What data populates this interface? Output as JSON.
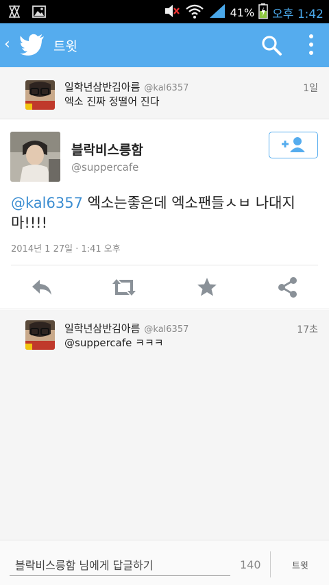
{
  "status_bar": {
    "battery": "41%",
    "time": "오후 1:42"
  },
  "header": {
    "title": "트윗"
  },
  "replies_above": [
    {
      "name": "일학년삼반김아름",
      "handle": "@kal6357",
      "time": "1일",
      "text": "엑소 진짜 정떨어 진다"
    }
  ],
  "main_tweet": {
    "name": "블락비스릉함",
    "handle": "@suppercafe",
    "mention": "@kal6357",
    "text": " 엑소는좋은데 엑소팬들ㅅㅂ 나대지마!!!!",
    "date": "2014년 1 27일 · 1:41 오후"
  },
  "replies_below": [
    {
      "name": "일학년삼반김아름",
      "handle": "@kal6357",
      "time": "17초",
      "text": "@suppercafe ㅋㅋㅋ"
    }
  ],
  "compose": {
    "placeholder": "블락비스릉함 님에게 답글하기",
    "count": "140",
    "send_label": "트윗"
  },
  "colors": {
    "accent": "#55acee",
    "mention": "#3b8dd1",
    "status_time": "#4aa8ea"
  }
}
